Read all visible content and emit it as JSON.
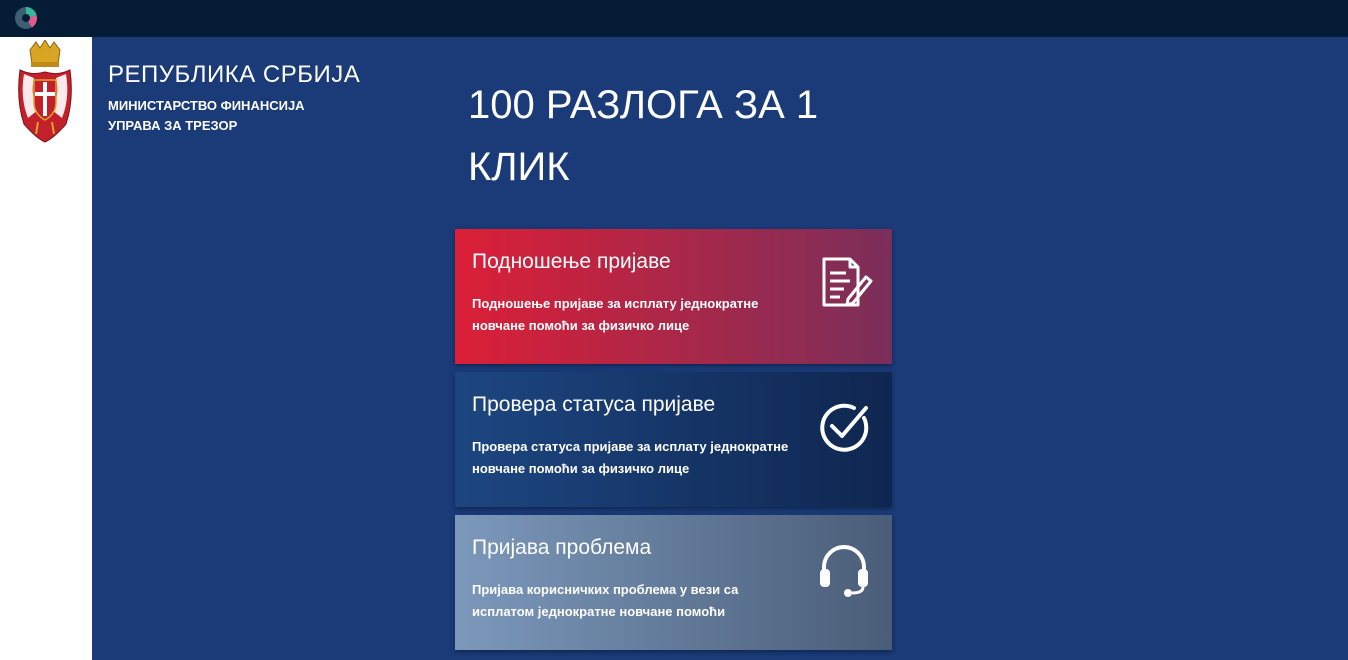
{
  "header": {
    "republic": "РЕПУБЛИКА СРБИЈА",
    "ministry": "МИНИСТАРСТВО ФИНАНСИЈА",
    "treasury": "УПРАВА ЗА ТРЕЗОР"
  },
  "headline": "100 РАЗЛОГА ЗА 1 КЛИК",
  "cards": [
    {
      "title": "Подношење пријаве",
      "description": "Подношење пријаве за исплату једнократне новчане помоћи за физичко лице",
      "icon": "document-edit-icon"
    },
    {
      "title": "Провера статуса пријаве",
      "description": "Провера статуса пријаве за исплату једнократне новчане помоћи за физичко лице",
      "icon": "check-circle-icon"
    },
    {
      "title": "Пријава проблема",
      "description": "Пријава корисничких проблема у вези са исплатом једнократне новчане помоћи",
      "icon": "headset-icon"
    }
  ],
  "colors": {
    "topbar": "#041c35",
    "background": "#1a3a78",
    "card1_start": "#dc1f37",
    "card1_end": "#7a2f5a",
    "card2_start": "#1d4681",
    "card2_end": "#0f2650",
    "card3_start": "#7b98bb",
    "card3_end": "#4a5d78"
  }
}
